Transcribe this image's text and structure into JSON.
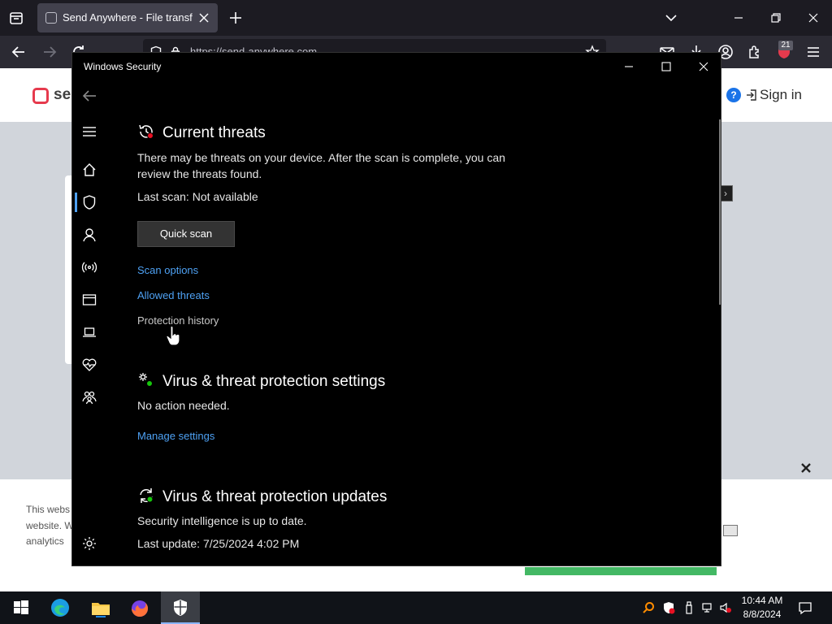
{
  "browser": {
    "tab_title": "Send Anywhere - File transfer",
    "url": "https://send-anywhere.com",
    "extension_badge": "21"
  },
  "webpage": {
    "logo_text": "ser",
    "help_label": "?",
    "signin_label": "Sign in",
    "arrow_box": "›",
    "cookie_lines": [
      "This webs",
      "website. W",
      "analytics"
    ]
  },
  "security_window": {
    "title": "Windows Security",
    "current_threats": {
      "heading": "Current threats",
      "description_line1": "There may be threats on your device. After the scan is complete, you can",
      "description_line2": "review the threats found.",
      "last_scan": "Last scan: Not available",
      "quick_scan_label": "Quick scan",
      "scan_options_label": "Scan options",
      "allowed_threats_label": "Allowed threats",
      "protection_history_label": "Protection history"
    },
    "settings": {
      "heading": "Virus & threat protection settings",
      "status": "No action needed.",
      "manage_label": "Manage settings"
    },
    "updates": {
      "heading": "Virus & threat protection updates",
      "status": "Security intelligence is up to date.",
      "last_update": "Last update: 7/25/2024 4:02 PM"
    },
    "accent_color": "#4ea1f3"
  },
  "taskbar": {
    "time": "10:44 AM",
    "date": "8/8/2024"
  }
}
